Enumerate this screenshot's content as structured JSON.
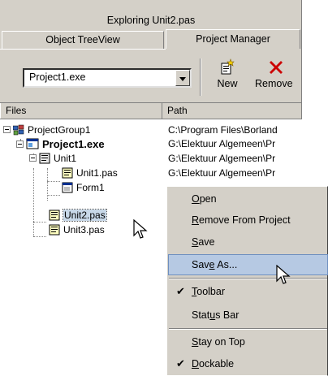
{
  "window": {
    "title": "Exploring Unit2.pas"
  },
  "tabs": [
    {
      "label": "Object TreeView",
      "active": false
    },
    {
      "label": "Project Manager",
      "active": true
    }
  ],
  "toolbar": {
    "project_combo": "Project1.exe",
    "new_label": "New",
    "remove_label": "Remove"
  },
  "columns": {
    "files": "Files",
    "path": "Path"
  },
  "tree": [
    {
      "name": "ProjectGroup1",
      "path": "C:\\Program Files\\Borland"
    },
    {
      "name": "Project1.exe",
      "path": "G:\\Elektuur Algemeen\\Pr"
    },
    {
      "name": "Unit1",
      "path": "G:\\Elektuur Algemeen\\Pr"
    },
    {
      "name": "Unit1.pas",
      "path": "G:\\Elektuur Algemeen\\Pr"
    },
    {
      "name": "Form1",
      "path": ""
    },
    {
      "name": "Unit2.pas",
      "path": ""
    },
    {
      "name": "Unit3.pas",
      "path": ""
    }
  ],
  "context_menu": {
    "items": [
      {
        "label_pre": "",
        "label_u": "O",
        "label_post": "pen",
        "checked": false
      },
      {
        "label_pre": "",
        "label_u": "R",
        "label_post": "emove From Project",
        "checked": false
      },
      {
        "label_pre": "",
        "label_u": "S",
        "label_post": "ave",
        "checked": false
      },
      {
        "label_pre": "Sav",
        "label_u": "e",
        "label_post": " As...",
        "checked": false,
        "highlighted": true
      },
      {
        "label_pre": "",
        "label_u": "T",
        "label_post": "oolbar",
        "checked": true
      },
      {
        "label_pre": "Stat",
        "label_u": "u",
        "label_post": "s Bar",
        "checked": false
      },
      {
        "label_pre": "",
        "label_u": "S",
        "label_post": "tay on Top",
        "checked": false
      },
      {
        "label_pre": "",
        "label_u": "D",
        "label_post": "ockable",
        "checked": true
      }
    ]
  },
  "colors": {
    "face": "#d4d0c8",
    "highlight": "#b6c9e3",
    "remove_x": "#cc0000"
  }
}
